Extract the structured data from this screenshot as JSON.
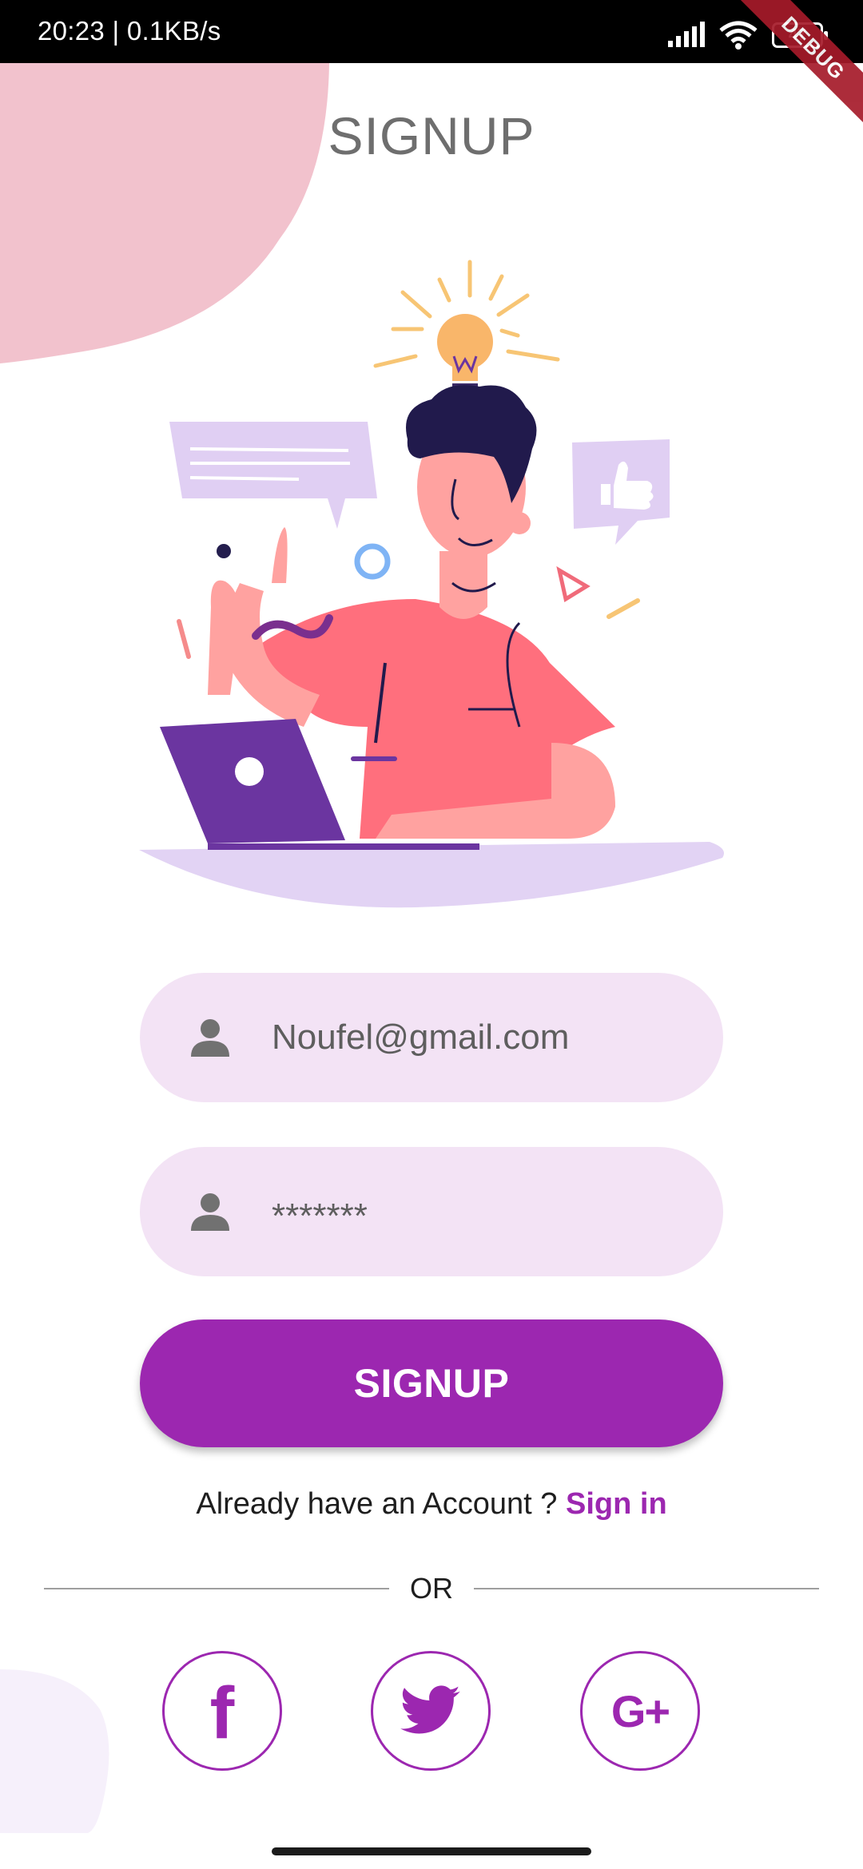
{
  "status_bar": {
    "time_speed": "20:23 | 0.1KB/s",
    "battery_level": "47",
    "debug_badge": "DEBUG"
  },
  "page": {
    "title": "SIGNUP"
  },
  "form": {
    "email_value": "Noufel@gmail.com",
    "password_value": "*******",
    "email_icon": "person-icon",
    "password_icon": "person-icon",
    "submit_label": "SIGNUP"
  },
  "account": {
    "prompt": "Already have an Account ? ",
    "link_label": "Sign in"
  },
  "divider": {
    "label": "OR"
  },
  "social": {
    "facebook_glyph": "f",
    "facebook_icon": "facebook-icon",
    "twitter_icon": "twitter-icon",
    "google_glyph": "G+",
    "google_icon": "google-plus-icon"
  },
  "colors": {
    "primary": "#9c27b0",
    "input_background": "#f3e3f5",
    "blob_pink": "#f2c2cd",
    "illustration_shirt": "#ff6f7d",
    "illustration_laptop": "#6b35a0"
  }
}
